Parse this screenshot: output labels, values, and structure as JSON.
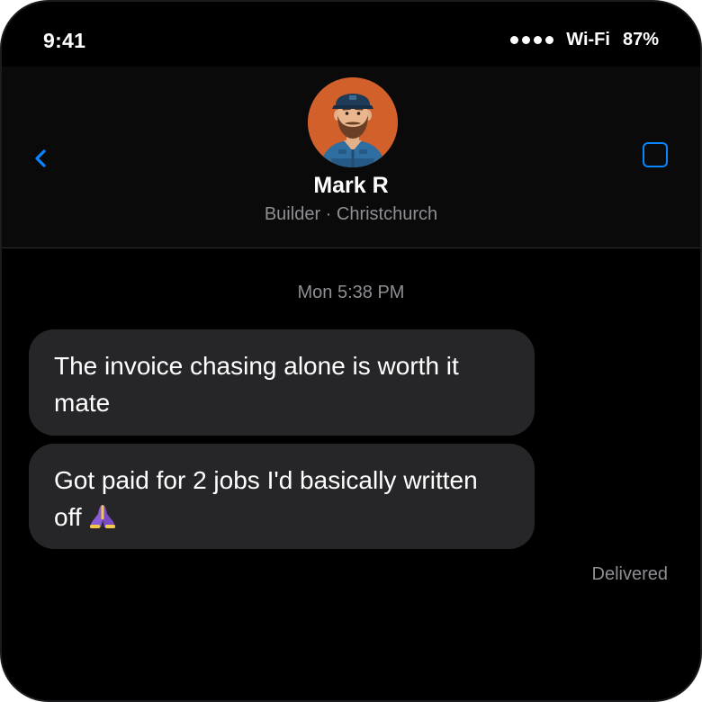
{
  "status_bar": {
    "time": "9:41",
    "network": "Wi-Fi",
    "battery": "87%"
  },
  "header": {
    "back_icon": "chevron-left-icon",
    "action_icon": "square-icon",
    "accent_color": "#0a84ff",
    "contact": {
      "name": "Mark R",
      "subtitle": "Builder · Christchurch",
      "avatar_icon": "bearded-builder-avatar"
    }
  },
  "conversation": {
    "timestamp": "Mon 5:38 PM",
    "messages": [
      {
        "text": "The invoice chasing alone is worth it mate"
      },
      {
        "text": "Got paid for 2 jobs I'd basically written off",
        "emoji": "folded-hands-icon"
      }
    ],
    "status": "Delivered"
  },
  "colors": {
    "background": "#000000",
    "header_background": "#0a0a0b",
    "bubble": "#262629",
    "secondary_text": "#8e8e93",
    "avatar_background": "#d2602a"
  }
}
